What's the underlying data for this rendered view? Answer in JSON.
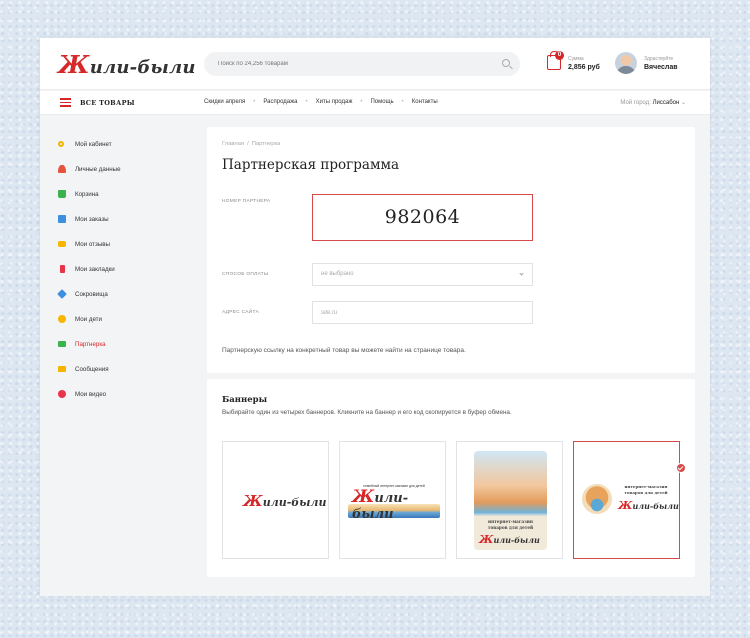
{
  "header": {
    "logo_first": "Ж",
    "logo_rest": "или-были",
    "search_placeholder": "Поиск по 24,256 товарам",
    "cart_count": "0",
    "sum_label": "Сумма",
    "sum_value": "2,856 руб",
    "greeting_label": "Здраствуйте",
    "user_name": "Вячеслав"
  },
  "nav": {
    "all_goods": "ВСЕ ТОВАРЫ",
    "links": [
      "Скидки апреля",
      "Распродажа",
      "Хиты продаж",
      "Помощь",
      "Контакты"
    ],
    "separator": "•",
    "city_label": "Мой город:",
    "city_name": "Лиссабон",
    "city_chevron": "⌄"
  },
  "sidebar": {
    "items": [
      {
        "label": "Мой кабинет",
        "icon": "key-icon",
        "color": "#f2b400"
      },
      {
        "label": "Личные данные",
        "icon": "user-icon",
        "color": "#e8533d"
      },
      {
        "label": "Корзина",
        "icon": "bag-icon",
        "color": "#3cb34a"
      },
      {
        "label": "Мои заказы",
        "icon": "orders-icon",
        "color": "#3d8fe0"
      },
      {
        "label": "Мои отзывы",
        "icon": "comment-icon",
        "color": "#f7b500"
      },
      {
        "label": "Мои закладки",
        "icon": "bookmark-icon",
        "color": "#e8334a"
      },
      {
        "label": "Сокровища",
        "icon": "diamond-icon",
        "color": "#3d8fe0"
      },
      {
        "label": "Мои дети",
        "icon": "kids-icon",
        "color": "#f7b500"
      },
      {
        "label": "Партнерка",
        "icon": "partner-icon",
        "color": "#3cb34a"
      },
      {
        "label": "Сообщения",
        "icon": "mail-icon",
        "color": "#f7b500"
      },
      {
        "label": "Мои видео",
        "icon": "video-icon",
        "color": "#e8334a"
      }
    ],
    "active_index": 8
  },
  "main": {
    "breadcrumb": [
      "Главная",
      "Партнерка"
    ],
    "breadcrumb_sep": "/",
    "title": "Партнерская программа",
    "partner_number_label": "НОМЕР ПАРТНЕРА",
    "partner_number": "982064",
    "payment_label": "СПОСОБ ОПЛАТЫ",
    "payment_value": "не выбрано",
    "site_label": "АДРЕС САЙТА",
    "site_placeholder": "site.ru",
    "info_text": "Партнерскую ссылку на конкретный товар вы можете найти на странице товара."
  },
  "banners": {
    "title": "Баннеры",
    "description": "Выбирайте один из четырех  баннеров. Кликните на баннер и его код скопируется в буфер обмена.",
    "banner2_tagline": "семейный интернет-магазин для детей",
    "banner3_text": [
      "интернет-магазин",
      "товаров для детей"
    ],
    "banner4_text": [
      "интернет-магазин",
      "товаров для детей"
    ],
    "selected_index": 3
  }
}
